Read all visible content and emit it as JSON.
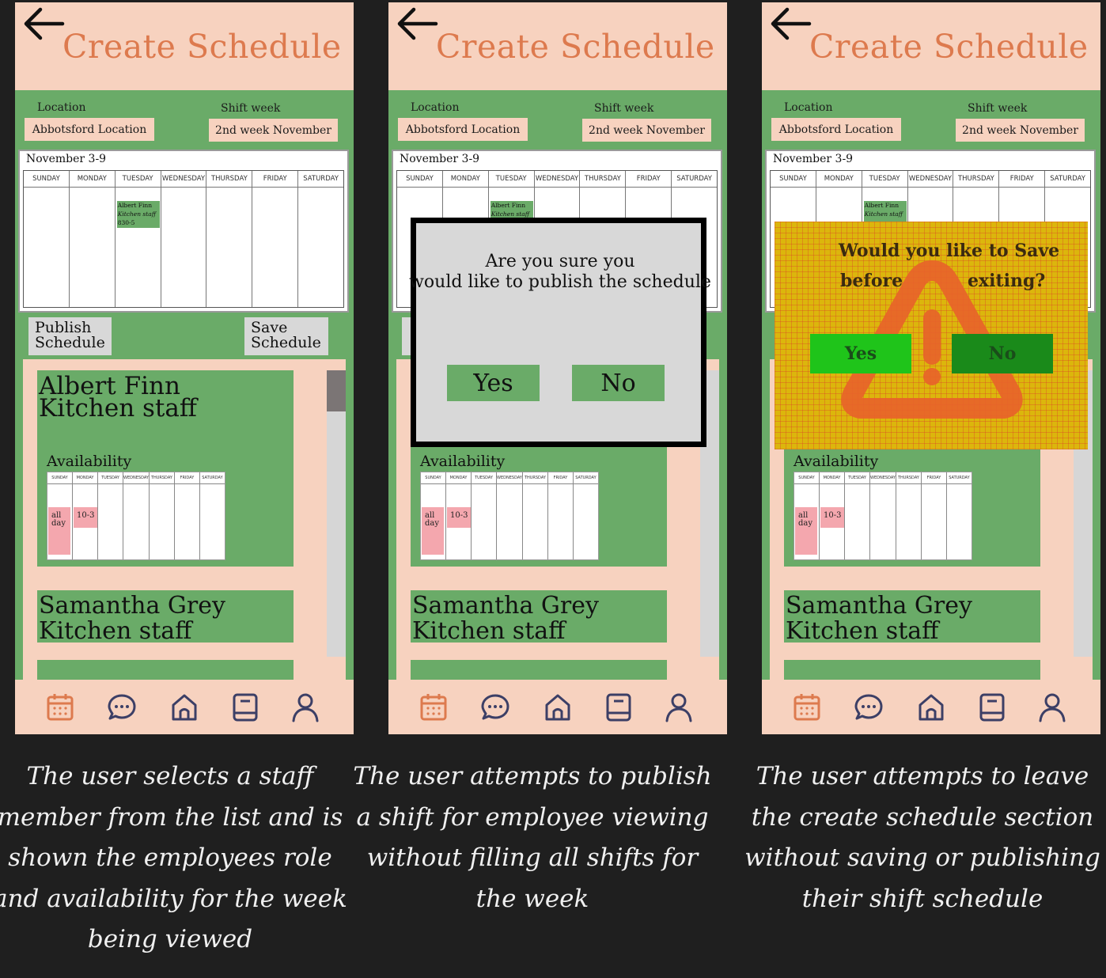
{
  "screens": [
    {
      "header": {
        "title": "Create Schedule"
      },
      "form": {
        "location_label": "Location",
        "location_value": "Abbotsford Location",
        "shift_week_label": "Shift week",
        "shift_week_value": "2nd week November"
      },
      "calendar": {
        "title": "November 3-9",
        "days": [
          "SUNDAY",
          "MONDAY",
          "TUESDAY",
          "WEDNESDAY",
          "THURSDAY",
          "FRIDAY",
          "SATURDAY"
        ],
        "shift": {
          "line1": "Albert Finn",
          "line2": "Kitchen staff",
          "line3": "830-5"
        }
      },
      "actions": {
        "publish": "Publish Schedule",
        "save": "Save Schedule"
      },
      "staff": [
        {
          "name": "Albert Finn",
          "role": "Kitchen staff"
        },
        {
          "name": "Samantha Grey",
          "role": "Kitchen staff"
        }
      ],
      "availability": {
        "label": "Availability",
        "sunday": "all day",
        "monday": "10-3"
      },
      "caption": "The user selects a staff member from the list and is shown the employees role and availability for the week being viewed"
    },
    {
      "header": {
        "title": "Create Schedule"
      },
      "form": {
        "location_label": "Location",
        "location_value": "Abbotsford Location",
        "shift_week_label": "Shift week",
        "shift_week_value": "2nd week November"
      },
      "calendar": {
        "title": "November 3-9",
        "days": [
          "SUNDAY",
          "MONDAY",
          "TUESDAY",
          "WEDNESDAY",
          "THURSDAY",
          "FRIDAY",
          "SATURDAY"
        ],
        "shift": {
          "line1": "Albert Finn",
          "line2": "Kitchen staff",
          "line3": ""
        }
      },
      "staff": [
        {
          "name": "",
          "role": ""
        },
        {
          "name": "Samantha Grey",
          "role": "Kitchen staff"
        }
      ],
      "availability": {
        "label": "Availability",
        "sunday": "all day",
        "monday": "10-3"
      },
      "dialog": {
        "line1": "Are you sure you",
        "line2": "would like to publish the schedule",
        "yes": "Yes",
        "no": "No"
      },
      "caption": "The user attempts to publish a shift for employee viewing without filling all shifts for the week"
    },
    {
      "header": {
        "title": "Create Schedule"
      },
      "form": {
        "location_label": "Location",
        "location_value": "Abbotsford Location",
        "shift_week_label": "Shift week",
        "shift_week_value": "2nd week November"
      },
      "calendar": {
        "title": "November 3-9",
        "days": [
          "SUNDAY",
          "MONDAY",
          "TUESDAY",
          "WEDNESDAY",
          "THURSDAY",
          "FRIDAY",
          "SATURDAY"
        ],
        "shift": {
          "line1": "Albert Finn",
          "line2": "Kitchen staff",
          "line3": ""
        }
      },
      "staff": [
        {
          "name": "",
          "role": ""
        },
        {
          "name": "Samantha Grey",
          "role": "Kitchen staff"
        }
      ],
      "availability": {
        "label": "Availability",
        "sunday": "all day",
        "monday": "10-3"
      },
      "dialog": {
        "line1": "Would you like to Save",
        "line2a": "before",
        "line2b": "exiting?",
        "yes": "Yes",
        "no": "No",
        "icon": "warning-icon"
      },
      "caption": "The user attempts to leave the create schedule section without saving or publishing their shift schedule"
    }
  ],
  "nav_icons": [
    "calendar-icon",
    "chat-icon",
    "home-icon",
    "book-icon",
    "profile-icon"
  ],
  "colors": {
    "background": "#1f1f1f",
    "panel_green": "#6aab68",
    "peach": "#f7d2bf",
    "title_orange": "#dd7a4e",
    "availability_pink": "#f4a7ae",
    "dialog_gray": "#d8d8d8",
    "warning_yellow": "#dcb60c"
  }
}
